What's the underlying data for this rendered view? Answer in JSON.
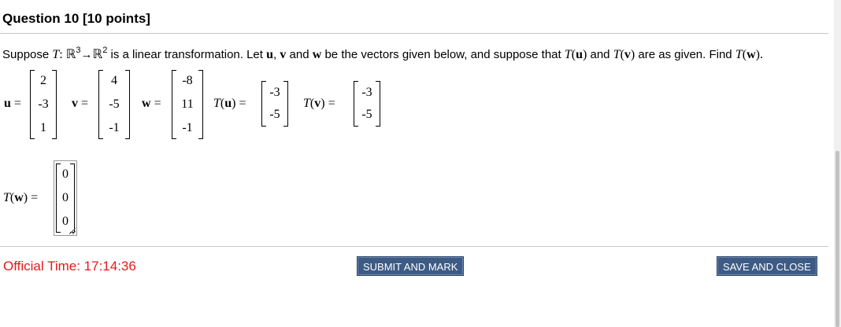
{
  "question": {
    "title": "Question 10 [10 points]"
  },
  "prompt": {
    "pre": "Suppose ",
    "T": "T",
    "colon": ": ",
    "R": "ℝ",
    "exp3": "3",
    "arrow": "→",
    "exp2": "2",
    "mid1": " is a linear transformation. Let ",
    "u": "u",
    "comma": ", ",
    "v": "v",
    "and1": " and ",
    "w": "w",
    "mid2": " be the vectors given below, and suppose that ",
    "Tu_T": "T",
    "Tu_open": "(",
    "Tu_u": "u",
    "Tu_close": ")",
    "and2": " and ",
    "Tv_T": "T",
    "Tv_open": "(",
    "Tv_v": "v",
    "Tv_close": ")",
    "mid3": " are as given. Find ",
    "Tw_T": "T",
    "Tw_open": "(",
    "Tw_w": "w",
    "Tw_close": ")."
  },
  "vectors": {
    "u": {
      "label": "u",
      "eq": " =",
      "values": [
        "2",
        "-3",
        "1"
      ]
    },
    "v": {
      "label": "v",
      "eq": " =",
      "values": [
        "4",
        "-5",
        "-1"
      ]
    },
    "w": {
      "label": "w",
      "eq": " =",
      "values": [
        "-8",
        "11",
        "-1"
      ]
    },
    "Tu": {
      "T": "T",
      "open": "(",
      "arg": "u",
      "close": ") =",
      "values": [
        "-3",
        "-5"
      ]
    },
    "Tv": {
      "T": "T",
      "open": "(",
      "arg": "v",
      "close": ") =",
      "values": [
        "-3",
        "-5"
      ]
    }
  },
  "answer": {
    "T": "T",
    "open": "(",
    "arg": "w",
    "close": ") =",
    "values": [
      "0",
      "0",
      "0"
    ]
  },
  "footer": {
    "timer": "Official Time: 17:14:36",
    "submit_label": "SUBMIT AND MARK",
    "save_label": "SAVE AND CLOSE"
  },
  "colors": {
    "timer": "#e21b1b",
    "button_bg": "#3d5b85"
  }
}
